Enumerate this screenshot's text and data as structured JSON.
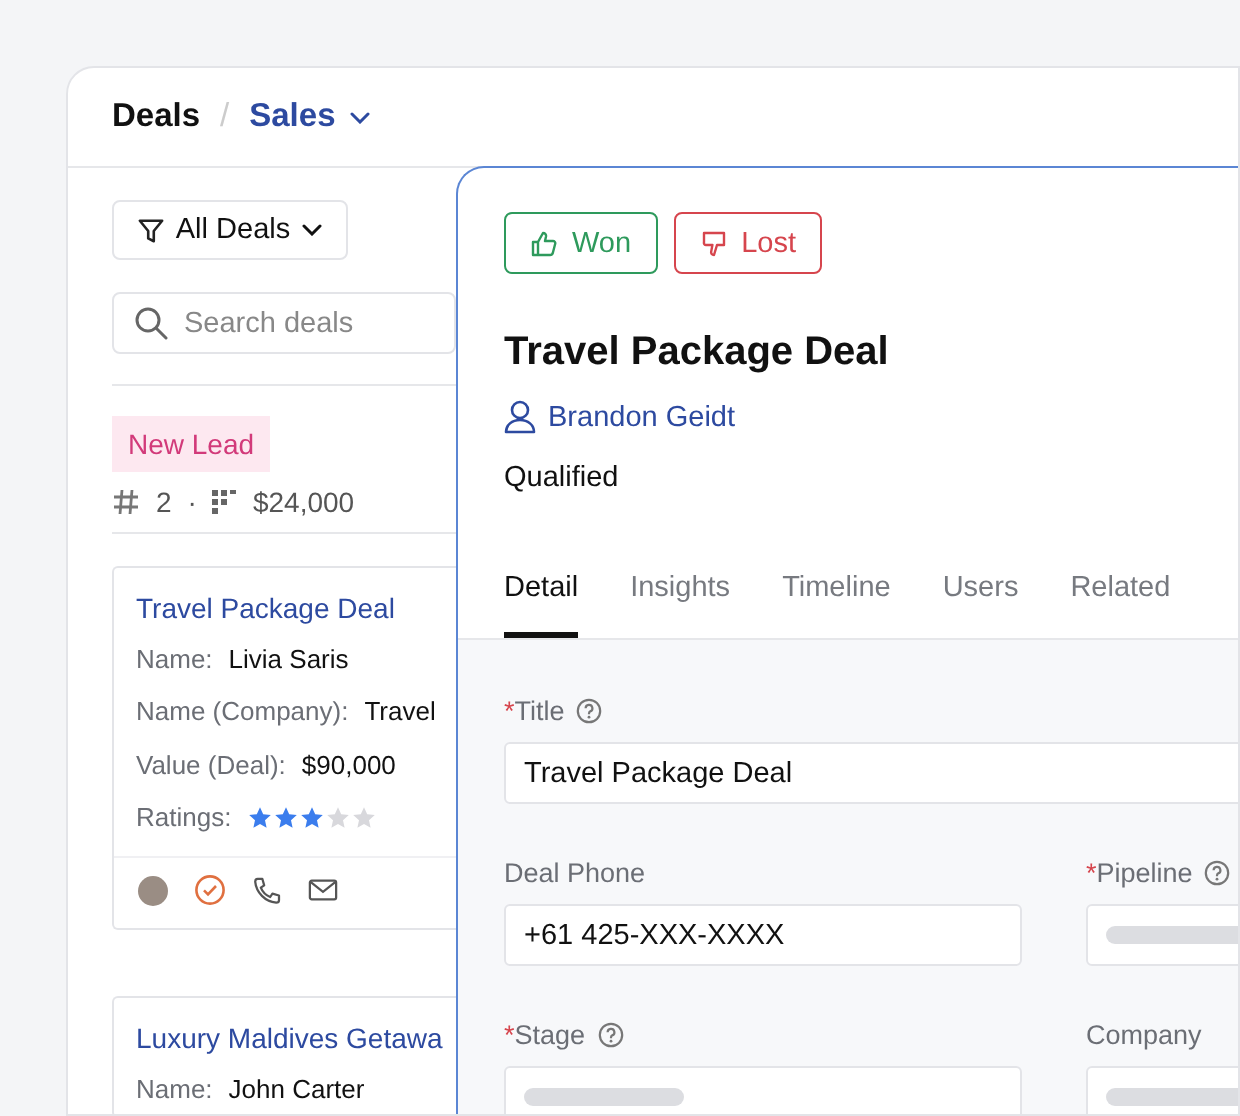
{
  "breadcrumb": {
    "root": "Deals",
    "separator": "/",
    "current": "Sales"
  },
  "filter": {
    "label": "All Deals"
  },
  "search": {
    "placeholder": "Search deals"
  },
  "stage_group": {
    "tag": "New Lead",
    "count": "2",
    "separator": "·",
    "total": "$24,000"
  },
  "deal_cards": [
    {
      "title": "Travel Package Deal",
      "fields": [
        {
          "kind": "text",
          "label": "Name:",
          "value": "Livia Saris"
        },
        {
          "kind": "text",
          "label": "Name (Company):",
          "value": "Travel"
        },
        {
          "kind": "text",
          "label": "Value (Deal):",
          "value": "$90,000"
        },
        {
          "kind": "stars",
          "label": "Ratings:",
          "stars": 3
        }
      ],
      "actions": true
    },
    {
      "title": "Luxury Maldives Getawa",
      "fields": [
        {
          "kind": "text",
          "label": "Name:",
          "value": "John Carter"
        }
      ]
    }
  ],
  "detail": {
    "buttons": [
      {
        "kind": "won",
        "label": "Won"
      },
      {
        "kind": "lost",
        "label": "Lost"
      }
    ],
    "title": "Travel Package Deal",
    "owner": "Brandon Geidt",
    "status": "Qualified",
    "tabs": [
      {
        "label": "Detail",
        "selected": true
      },
      {
        "label": "Insights",
        "selected": false
      },
      {
        "label": "Timeline",
        "selected": false
      },
      {
        "label": "Users",
        "selected": false
      },
      {
        "label": "Related",
        "selected": false
      }
    ],
    "form_rows": [
      [
        {
          "mark": "*",
          "label": "Title",
          "help": true,
          "loading": false,
          "value": "Travel Package Deal"
        }
      ],
      [
        {
          "label": "Deal Phone",
          "help": false,
          "loading": false,
          "value": "+61 425-XXX-XXXX"
        },
        {
          "mark": "*",
          "label": "Pipeline",
          "help": true,
          "loading": true
        }
      ],
      [
        {
          "mark": "*",
          "label": "Stage",
          "help": true,
          "loading": true
        },
        {
          "label": "Company",
          "help": false,
          "loading": true
        }
      ]
    ]
  }
}
